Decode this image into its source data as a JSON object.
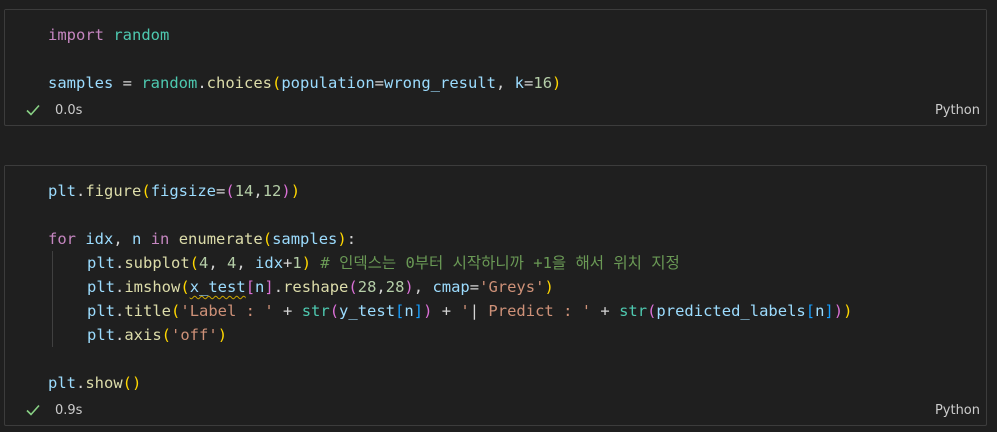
{
  "cells": [
    {
      "status": {
        "time": "0.0s",
        "language": "Python"
      }
    },
    {
      "status": {
        "time": "0.9s",
        "language": "Python"
      }
    }
  ],
  "code": {
    "c1l1": {
      "t1": "import",
      "t2": " ",
      "t3": "random"
    },
    "c1l3": {
      "t1": "samples",
      "t2": " = ",
      "t3": "random",
      "t4": ".",
      "t5": "choices",
      "t6": "(",
      "t7": "population",
      "t8": "=",
      "t9": "wrong_result",
      "t10": ", ",
      "t11": "k",
      "t12": "=",
      "t13": "16",
      "t14": ")"
    },
    "c2l1": {
      "t1": "plt",
      "t2": ".",
      "t3": "figure",
      "t4": "(",
      "t5": "figsize",
      "t6": "=",
      "t7": "(",
      "t8": "14",
      "t9": ",",
      "t10": "12",
      "t11": ")",
      "t12": ")"
    },
    "c2l3": {
      "t1": "for",
      "t2": " ",
      "t3": "idx",
      "t4": ", ",
      "t5": "n",
      "t6": " ",
      "t7": "in",
      "t8": " ",
      "t9": "enumerate",
      "t10": "(",
      "t11": "samples",
      "t12": ")",
      "t13": ":"
    },
    "c2l4": {
      "t1": "plt",
      "t2": ".",
      "t3": "subplot",
      "t4": "(",
      "t5": "4",
      "t6": ", ",
      "t7": "4",
      "t8": ", ",
      "t9": "idx",
      "t10": "+",
      "t11": "1",
      "t12": ")",
      "t13": " ",
      "t14": "# 인덱스는 0부터 시작하니까 +1을 해서 위치 지정"
    },
    "c2l5": {
      "t1": "plt",
      "t2": ".",
      "t3": "imshow",
      "t4": "(",
      "t5": "x_test",
      "t6": "[",
      "t7": "n",
      "t8": "]",
      "t9": ".",
      "t10": "reshape",
      "t11": "(",
      "t12": "28",
      "t13": ",",
      "t14": "28",
      "t15": ")",
      "t16": ", ",
      "t17": "cmap",
      "t18": "=",
      "t19": "'Greys'",
      "t20": ")"
    },
    "c2l6": {
      "t1": "plt",
      "t2": ".",
      "t3": "title",
      "t4": "(",
      "t5": "'Label : '",
      "t6": " + ",
      "t7": "str",
      "t8": "(",
      "t9": "y_test",
      "t10": "[",
      "t11": "n",
      "t12": "]",
      "t13": ")",
      "t14": " + ",
      "t15": "'",
      "t16": "|",
      "t17": " Predict : '",
      "t18": " + ",
      "t19": "str",
      "t20": "(",
      "t21": "predicted_labels",
      "t22": "[",
      "t23": "n",
      "t24": "]",
      "t25": ")",
      "t26": ")"
    },
    "c2l7": {
      "t1": "plt",
      "t2": ".",
      "t3": "axis",
      "t4": "(",
      "t5": "'off'",
      "t6": ")"
    },
    "c2l9": {
      "t1": "plt",
      "t2": ".",
      "t3": "show",
      "t4": "(",
      "t5": ")"
    }
  },
  "colors": {
    "background": "#1f1f1f",
    "success": "#89d185"
  },
  "icons": {
    "status": "checkmark-icon"
  }
}
